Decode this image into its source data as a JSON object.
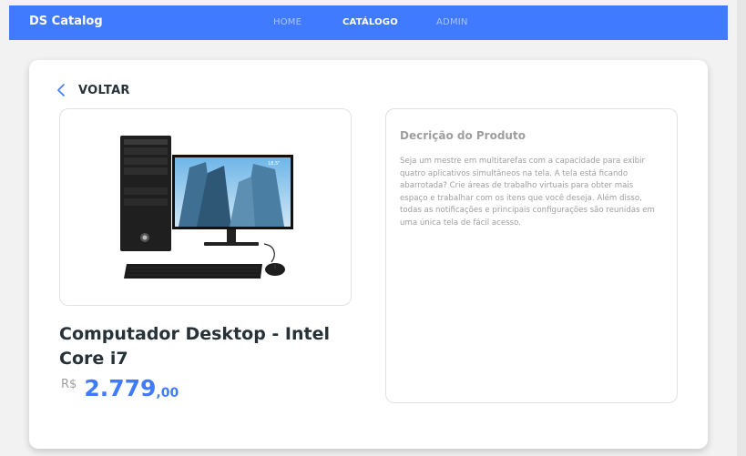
{
  "navbar": {
    "brand": "DS Catalog",
    "links": [
      {
        "label": "HOME"
      },
      {
        "label": "CATÁLOGO"
      },
      {
        "label": "ADMIN"
      }
    ]
  },
  "product": {
    "back_label": "VOLTAR",
    "name": "Computador Desktop - Intel Core i7",
    "price": {
      "currency": "R$",
      "integer": "2.779",
      "decimals": ",00"
    },
    "image_screen_label": "18,5\"",
    "description": {
      "title": "Decrição do Produto",
      "text": "Seja um mestre em multitarefas com a capacidade para exibir quatro aplicativos simultâneos na tela. A tela está ficando abarrotada? Crie áreas de trabalho virtuais para obter mais espaço e trabalhar com os itens que você deseja. Além disso, todas as notificações e principais configurações são reunidas em uma única tela de fácil acesso."
    }
  },
  "colors": {
    "primary": "#407bff",
    "text_dark": "#263238",
    "text_muted": "#9e9e9e"
  }
}
